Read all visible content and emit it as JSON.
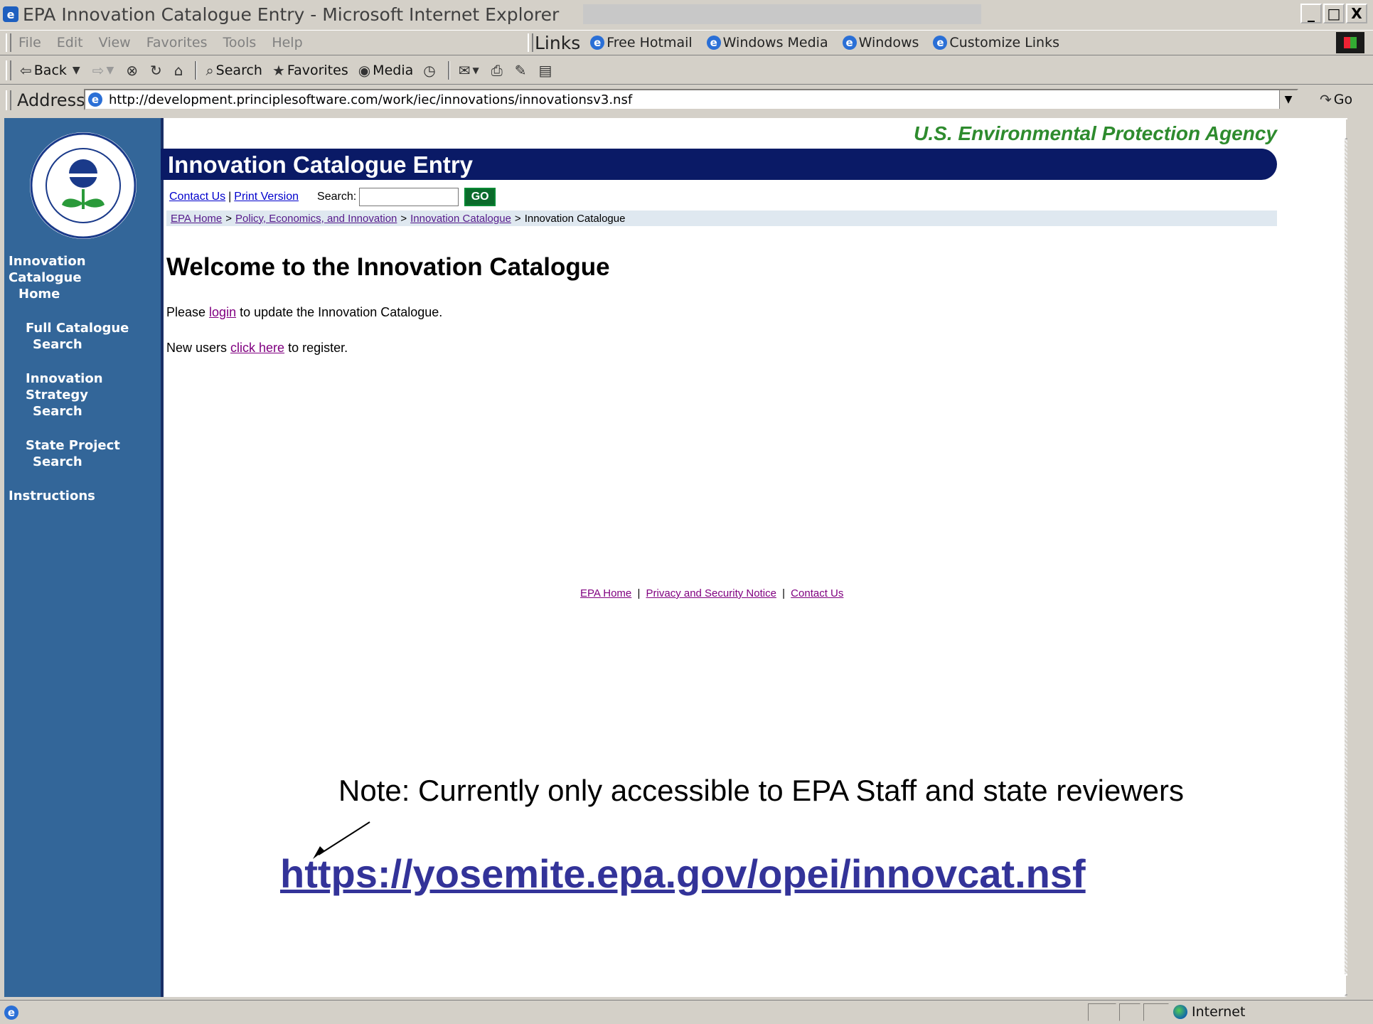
{
  "window": {
    "title": "EPA Innovation Catalogue Entry - Microsoft Internet Explorer",
    "controls": [
      "_",
      "□",
      "X"
    ]
  },
  "menubar": {
    "items": [
      "File",
      "Edit",
      "View",
      "Favorites",
      "Tools",
      "Help"
    ],
    "links_label": "Links",
    "links": [
      "Free Hotmail",
      "Windows Media",
      "Windows",
      "Customize Links"
    ]
  },
  "toolbar": {
    "back": "Back",
    "search": "Search",
    "favorites": "Favorites",
    "media": "Media"
  },
  "addressbar": {
    "label": "Address",
    "url": "http://development.principlesoftware.com/work/iec/innovations/innovationsv3.nsf",
    "go": "Go"
  },
  "page": {
    "agency": "U.S. Environmental Protection Agency",
    "banner_title": "Innovation Catalogue Entry",
    "utility": {
      "contact": "Contact Us",
      "print": "Print Version",
      "search_label": "Search:",
      "search_value": "",
      "go": "GO"
    },
    "breadcrumb": {
      "items": [
        "EPA Home",
        "Policy, Economics, and Innovation",
        "Innovation Catalogue"
      ],
      "current": "Innovation Catalogue",
      "separator": ">"
    },
    "sidebar": {
      "items": [
        {
          "line1": "Innovation Catalogue",
          "line2": "Home"
        },
        {
          "line1": "Full Catalogue",
          "line2": "Search"
        },
        {
          "line1": "Innovation Strategy",
          "line2": "Search"
        },
        {
          "line1": "State Project",
          "line2": "Search"
        },
        {
          "line1": "Instructions",
          "line2": ""
        }
      ]
    },
    "heading": "Welcome to the Innovation Catalogue",
    "login_prefix": "Please ",
    "login_link": "login",
    "login_suffix": " to update the Innovation Catalogue.",
    "register_prefix": "New users ",
    "register_link": "click here",
    "register_suffix": " to register.",
    "footer": {
      "epa_home": "EPA Home",
      "privacy": "Privacy and Security Notice",
      "contact": "Contact Us"
    },
    "note": "Note: Currently only accessible to EPA Staff and state reviewers",
    "big_url": "https://yosemite.epa.gov/opei/innovcat.nsf"
  },
  "statusbar": {
    "zone": "Internet"
  },
  "colors": {
    "sidebar_bg": "#336699",
    "banner_bg": "#0a1a66",
    "agency_green": "#2e8b2e",
    "big_url": "#333399"
  }
}
